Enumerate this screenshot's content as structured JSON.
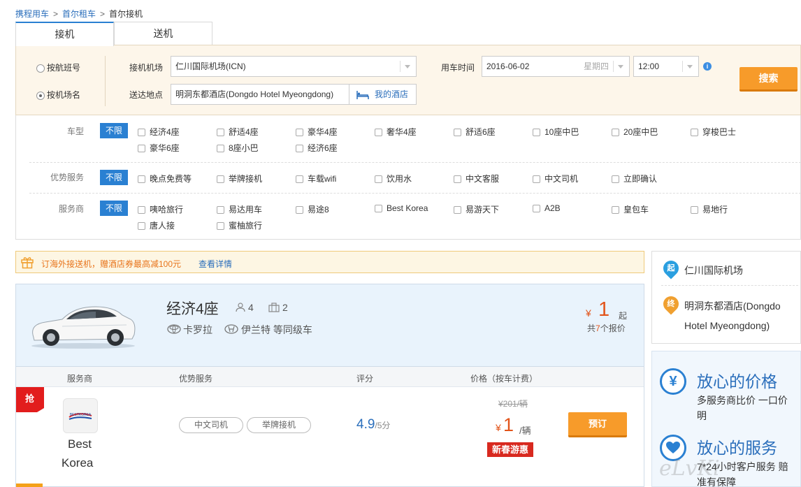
{
  "breadcrumb": {
    "item1": "携程用车",
    "item2": "首尔租车",
    "current": "首尔接机",
    "sep": ">"
  },
  "tabs": {
    "pickup": "接机",
    "dropoff": "送机"
  },
  "search": {
    "radio_flight": "按航班号",
    "radio_airport": "按机场名",
    "airport_label": "接机机场",
    "airport_value": "仁川国际机场(ICN)",
    "dest_label": "送达地点",
    "dest_value": "明洞东都酒店(Dongdo Hotel Myeongdong)",
    "my_hotel": "我的酒店",
    "time_label": "用车时间",
    "date_value": "2016-06-02",
    "weekday": "星期四",
    "time_value": "12:00",
    "info_icon": "i",
    "search_btn": "搜索"
  },
  "filters": {
    "all_label": "不限",
    "car_type": {
      "label": "车型",
      "options": [
        "经济4座",
        "舒适4座",
        "豪华4座",
        "奢华4座",
        "舒适6座",
        "10座中巴",
        "20座中巴",
        "穿梭巴士",
        "豪华6座",
        "8座小巴",
        "经济6座"
      ]
    },
    "service": {
      "label": "优势服务",
      "options": [
        "晚点免费等",
        "举牌接机",
        "车载wifi",
        "饮用水",
        "中文客服",
        "中文司机",
        "立即确认"
      ]
    },
    "provider": {
      "label": "服务商",
      "options": [
        "咦哈旅行",
        "易达用车",
        "易途8",
        "Best Korea",
        "易游天下",
        "A2B",
        "皇包车",
        "易地行",
        "唐人接",
        "蜜柚旅行"
      ]
    }
  },
  "promo": {
    "text": "订海外接送机，赠酒店券最高减100元",
    "link": "查看详情"
  },
  "car": {
    "name": "经济4座",
    "passengers": "4",
    "luggage": "2",
    "model1": "卡罗拉",
    "model2": "伊兰特 等同级车",
    "currency": "¥",
    "price_from": "1",
    "from_suffix": "起",
    "quote_prefix": "共",
    "quote_count": "7",
    "quote_suffix": "个报价"
  },
  "table": {
    "col_provider": "服务商",
    "col_service": "优势服务",
    "col_rating": "评分",
    "col_price": "价格（按车计费）"
  },
  "offer": {
    "badge": "抢",
    "provider_line1": "Best",
    "provider_line2": "Korea",
    "logo_text": "BESTKOREA",
    "tag1": "中文司机",
    "tag2": "举牌接机",
    "rating": "4.9",
    "rating_suffix": "/5分",
    "old_price": "¥201/辆",
    "currency": "¥",
    "price": "1",
    "unit": "/辆",
    "promo_tag": "新春游惠",
    "book_btn": "预订"
  },
  "route": {
    "start_badge": "起",
    "start": "仁川国际机场",
    "end_badge": "终",
    "end_line1": "明洞东都酒店(Dongdo",
    "end_line2": "Hotel Myeongdong)"
  },
  "assurance": {
    "price_title": "放心的价格",
    "price_desc1": "多服务商比价   一口价",
    "price_desc2": "明",
    "service_title": "放心的服务",
    "service_desc1": "7*24小时客户服务  赔",
    "service_desc2": "准有保障",
    "yen_icon": "¥",
    "watermark": "eLvKi"
  },
  "colors": {
    "accent": "#2a80d2",
    "orange": "#f79b2a",
    "price_red": "#e2541a",
    "link": "#2a6ebb"
  }
}
